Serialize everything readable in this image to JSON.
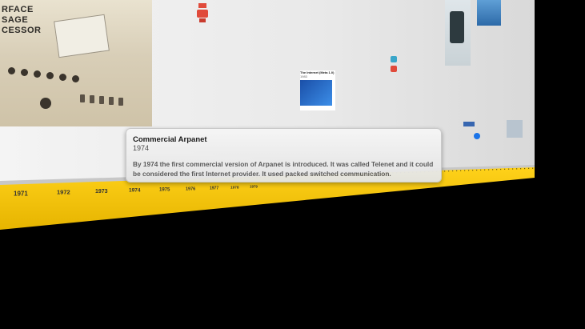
{
  "photo_card": {
    "label_lines": [
      "RFACE",
      "SAGE",
      "CESSOR"
    ]
  },
  "tooltip": {
    "title": "Commercial Arpanet",
    "year": "1974",
    "description": "By 1974 the first commercial version of Arpanet is introduced. It was called Telenet and it could be considered the first Internet provider. It used packed switched communication."
  },
  "timeline": {
    "years": [
      "1971",
      "1972",
      "1973",
      "1974",
      "1975",
      "1976",
      "1977",
      "1978",
      "1979"
    ],
    "bar_color": "#f2c200",
    "tick_color": "#6b5a10"
  },
  "background_cards": {
    "internet_card_title": "The Internet (Meta 1.0)",
    "internet_card_year": "1983"
  }
}
